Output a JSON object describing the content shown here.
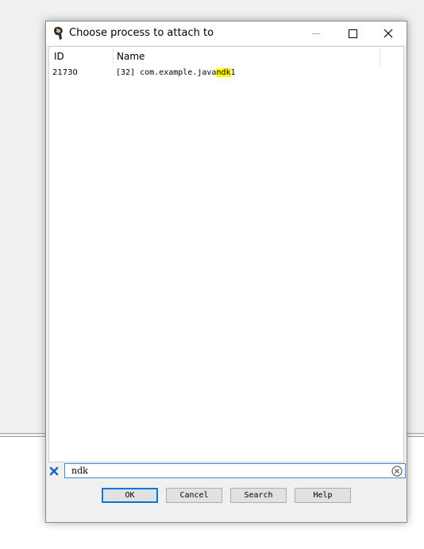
{
  "dialog": {
    "title": "Choose process to attach to",
    "icons": {
      "app": "android-studio-icon",
      "minimize": "minimize-icon",
      "maximize": "maximize-icon",
      "close": "close-icon"
    }
  },
  "table": {
    "columns": [
      "ID",
      "Name"
    ],
    "rows": [
      {
        "id": "21730",
        "name_prefix": "[32] com.example.java",
        "name_match": "ndk",
        "name_suffix": "1"
      }
    ],
    "highlight_color": "#ffff00"
  },
  "filter": {
    "value": "ndk",
    "clear_filter_icon": "blue-x-icon",
    "clear_input_icon": "circle-x-icon"
  },
  "buttons": {
    "ok": "OK",
    "cancel": "Cancel",
    "search": "Search",
    "help": "Help"
  },
  "colors": {
    "accent": "#0078d7",
    "filter_border": "#3c8ad8"
  }
}
